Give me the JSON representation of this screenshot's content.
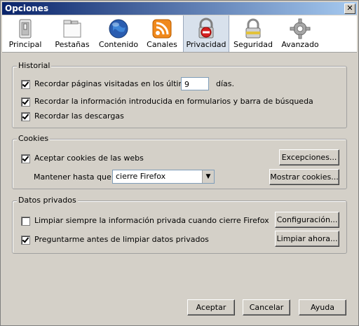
{
  "window": {
    "title": "Opciones"
  },
  "tabs": [
    {
      "label": "Principal",
      "icon": "switch-icon"
    },
    {
      "label": "Pestañas",
      "icon": "tabs-icon"
    },
    {
      "label": "Contenido",
      "icon": "globe-icon"
    },
    {
      "label": "Canales",
      "icon": "rss-icon"
    },
    {
      "label": "Privacidad",
      "icon": "privacy-icon"
    },
    {
      "label": "Seguridad",
      "icon": "padlock-icon"
    },
    {
      "label": "Avanzado",
      "icon": "gear-icon"
    }
  ],
  "selected_tab": "Privacidad",
  "historial": {
    "title": "Historial",
    "remember_pages_label": "Recordar páginas visitadas en los últimos",
    "days_value": "9",
    "days_label": "días.",
    "remember_forms_label": "Recordar la información introducida en formularios y barra de búsqueda",
    "remember_downloads_label": "Recordar las descargas"
  },
  "cookies": {
    "title": "Cookies",
    "accept_label": "Aceptar cookies de las webs",
    "exceptions_button": "Excepciones...",
    "keep_until_label": "Mantener hasta que:",
    "keep_until_value": "cierre Firefox",
    "show_cookies_button": "Mostrar cookies..."
  },
  "private_data": {
    "title": "Datos privados",
    "always_clear_label": "Limpiar siempre la información privada cuando cierre Firefox",
    "settings_button": "Configuración...",
    "ask_before_label": "Preguntarme antes de limpiar datos privados",
    "clear_now_button": "Limpiar ahora..."
  },
  "footer": {
    "accept_button": "Aceptar",
    "cancel_button": "Cancelar",
    "help_button": "Ayuda"
  }
}
